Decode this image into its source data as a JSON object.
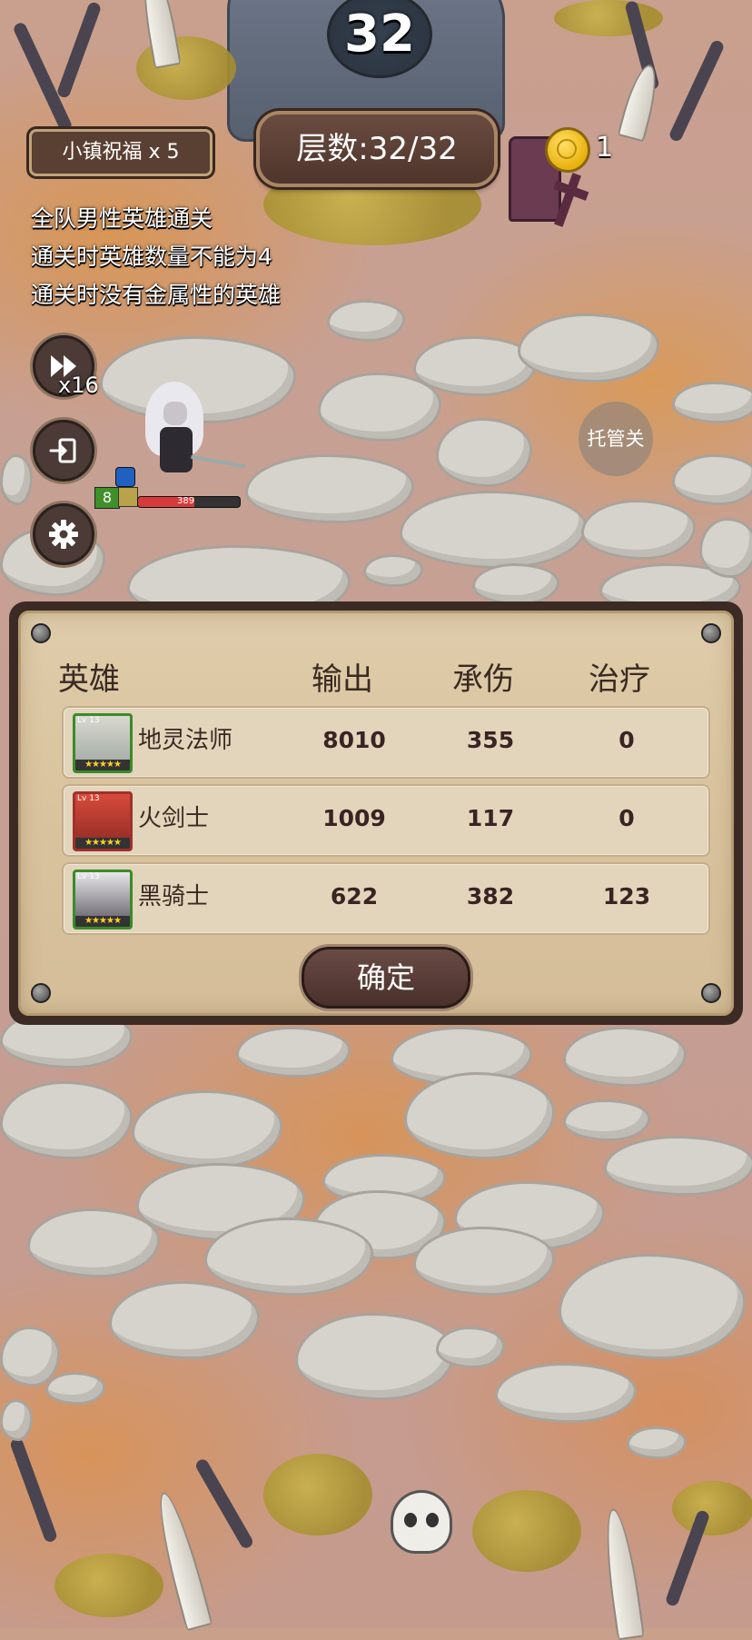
{
  "hud": {
    "stage_number": "32",
    "blessing": "小镇祝福 x 5",
    "floor": "层数:32/32",
    "coin_count": "1",
    "speed_label": "x16",
    "auto_label": "托管关"
  },
  "rules": [
    "全队男性英雄通关",
    "通关时英雄数量不能为4",
    "通关时没有金属性的英雄"
  ],
  "hero_unit": {
    "level": "8",
    "hp": "389"
  },
  "result_panel": {
    "headers": {
      "hero": "英雄",
      "output": "输出",
      "damage_taken": "承伤",
      "healing": "治疗"
    },
    "rows": [
      {
        "name": "地灵法师",
        "output": "8010",
        "damage_taken": "355",
        "healing": "0",
        "level": "Lv 13",
        "stars": "★★★★★"
      },
      {
        "name": "火剑士",
        "output": "1009",
        "damage_taken": "117",
        "healing": "0",
        "level": "Lv 13",
        "stars": "★★★★★"
      },
      {
        "name": "黑骑士",
        "output": "622",
        "damage_taken": "382",
        "healing": "123",
        "level": "Lv 13",
        "stars": "★★★★★"
      }
    ],
    "confirm_label": "确定"
  },
  "colors": {
    "panel_bg": "#dfccaa",
    "panel_border": "#3b2b24",
    "button_bg": "#4a302b",
    "text_dark": "#3a2a22",
    "hp_red": "#d73a3a"
  },
  "icons": {
    "fast_forward": "fast-forward-icon",
    "exit": "exit-icon",
    "settings": "gear-icon",
    "coin": "coin-icon"
  }
}
